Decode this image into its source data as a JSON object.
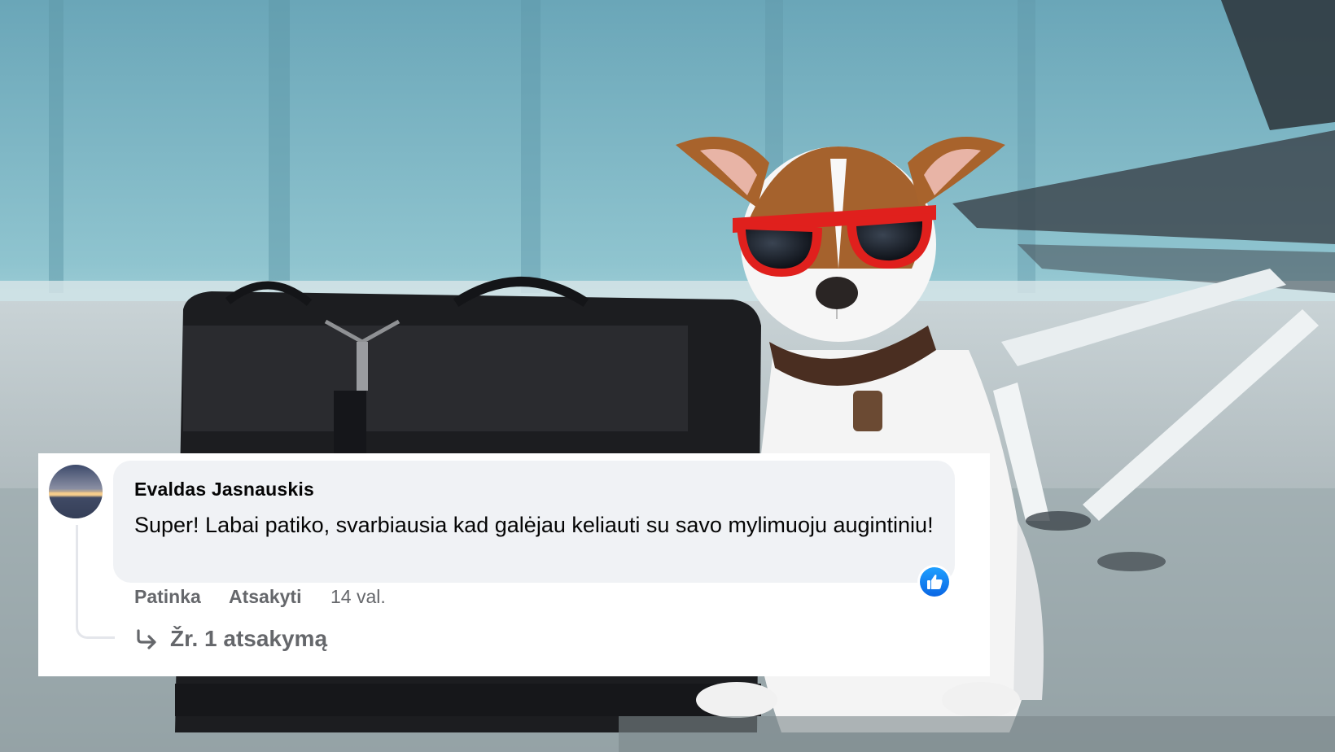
{
  "comment": {
    "author": "Evaldas Jasnauskis",
    "text": "Super! Labai patiko, svarbiausia kad galėjau keliauti su savo mylimuoju augintiniu!",
    "reaction_icon": "thumbs-up-icon",
    "like_label": "Patinka",
    "reply_label": "Atsakyti",
    "time": "14 val.",
    "view_replies_label": "Žr. 1 atsakymą",
    "reply_arrow_icon": "reply-arrow-icon"
  },
  "colors": {
    "accent_like": "#1877f2",
    "bubble_bg": "#f0f2f5",
    "text_primary": "#050505",
    "text_secondary": "#65676b"
  }
}
